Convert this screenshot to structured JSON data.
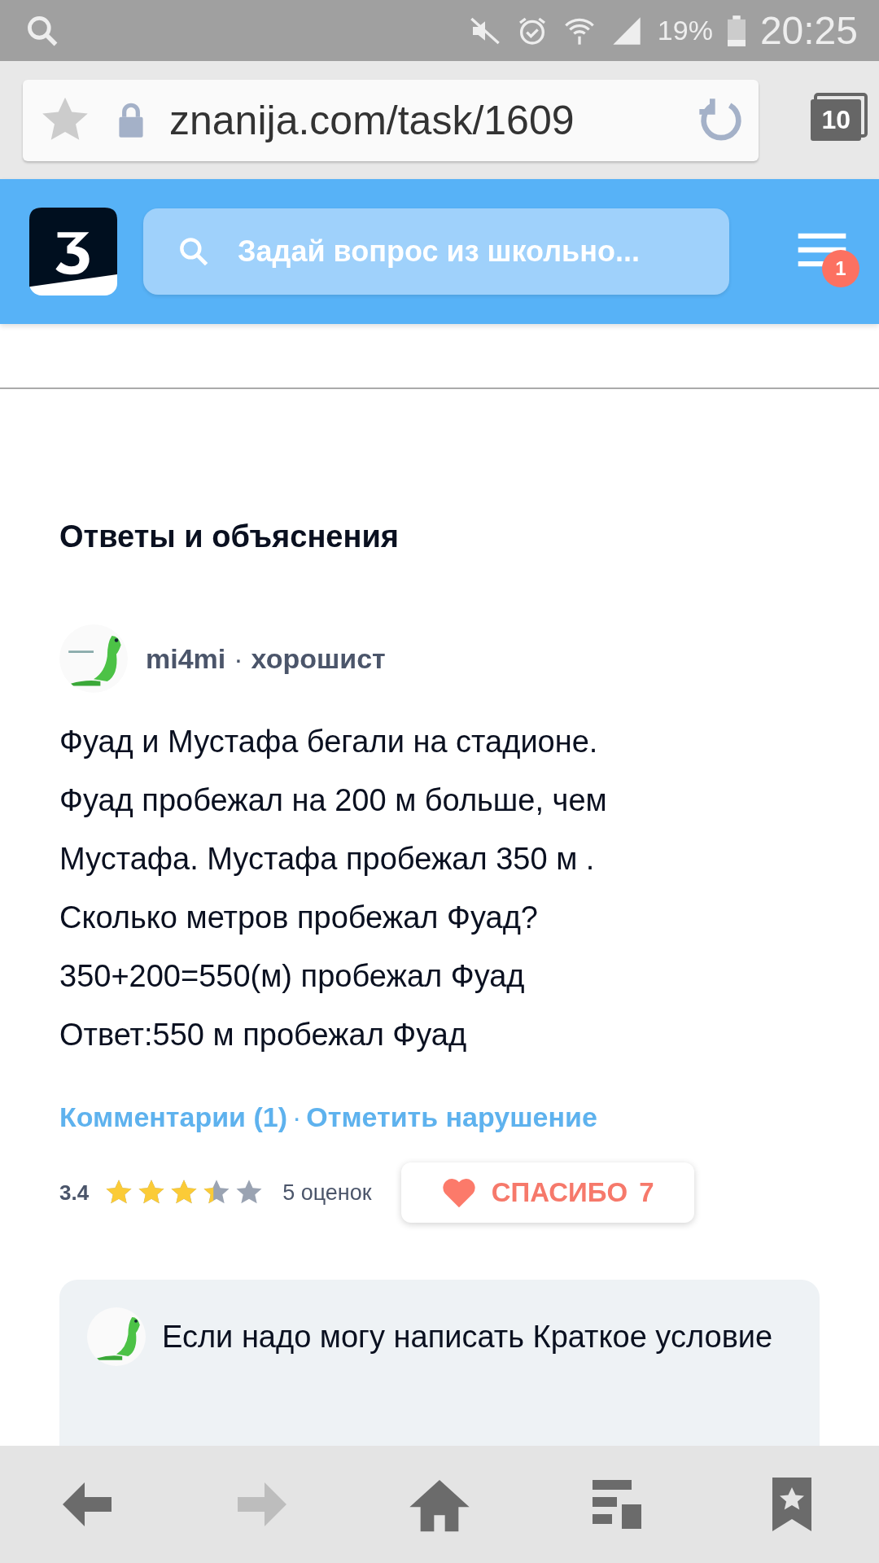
{
  "status_bar": {
    "battery": "19%",
    "time": "20:25"
  },
  "browser": {
    "url": "znanija.com/task/1609",
    "tabs_count": "10"
  },
  "header": {
    "search_placeholder": "Задай вопрос из школьно...",
    "notifications": "1"
  },
  "section_title": "Ответы и объяснения",
  "answer": {
    "author": "mi4mi",
    "rank": "хорошист",
    "separator": "·",
    "lines": [
      "Фуад и Мустафа бегали на стадионе.",
      "Фуад пробежал на 200 м больше, чем",
      "Мустафа. Мустафа пробежал 350 м .",
      "Сколько метров пробежал Фуад?",
      "350+200=550(м) пробежал Фуад",
      "Ответ:550 м пробежал Фуад"
    ],
    "comments_link": "Комментарии (1)",
    "report_link": "Отметить нарушение",
    "rating": "3.4",
    "stars": 3.4,
    "ratings_count": "5 оценок",
    "thanks_label": "СПАСИБО",
    "thanks_count": "7"
  },
  "comment": {
    "text": "Если надо могу написать Краткое условие"
  }
}
